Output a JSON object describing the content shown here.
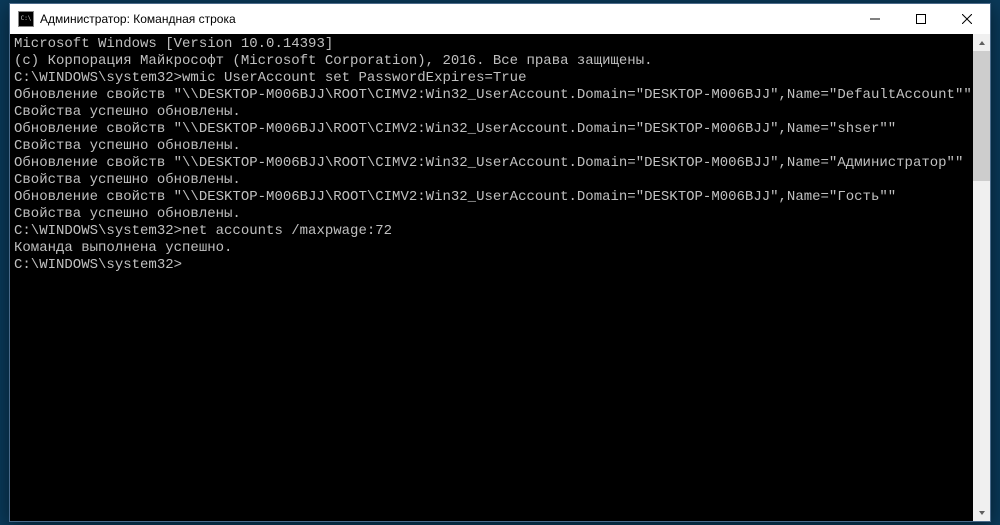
{
  "window": {
    "title": "Администратор: Командная строка"
  },
  "terminal": {
    "prompt": "C:\\WINDOWS\\system32>",
    "lines": [
      "Microsoft Windows [Version 10.0.14393]",
      "(c) Корпорация Майкрософт (Microsoft Corporation), 2016. Все права защищены.",
      "",
      "C:\\WINDOWS\\system32>wmic UserAccount set PasswordExpires=True",
      "Обновление свойств \"\\\\DESKTOP-M006BJJ\\ROOT\\CIMV2:Win32_UserAccount.Domain=\"DESKTOP-M006BJJ\",Name=\"DefaultAccount\"\"",
      "Свойства успешно обновлены.",
      "Обновление свойств \"\\\\DESKTOP-M006BJJ\\ROOT\\CIMV2:Win32_UserAccount.Domain=\"DESKTOP-M006BJJ\",Name=\"shser\"\"",
      "Свойства успешно обновлены.",
      "Обновление свойств \"\\\\DESKTOP-M006BJJ\\ROOT\\CIMV2:Win32_UserAccount.Domain=\"DESKTOP-M006BJJ\",Name=\"Администратор\"\"",
      "Свойства успешно обновлены.",
      "Обновление свойств \"\\\\DESKTOP-M006BJJ\\ROOT\\CIMV2:Win32_UserAccount.Domain=\"DESKTOP-M006BJJ\",Name=\"Гость\"\"",
      "Свойства успешно обновлены.",
      "",
      "C:\\WINDOWS\\system32>net accounts /maxpwage:72",
      "Команда выполнена успешно.",
      "",
      "",
      "C:\\WINDOWS\\system32>"
    ]
  }
}
